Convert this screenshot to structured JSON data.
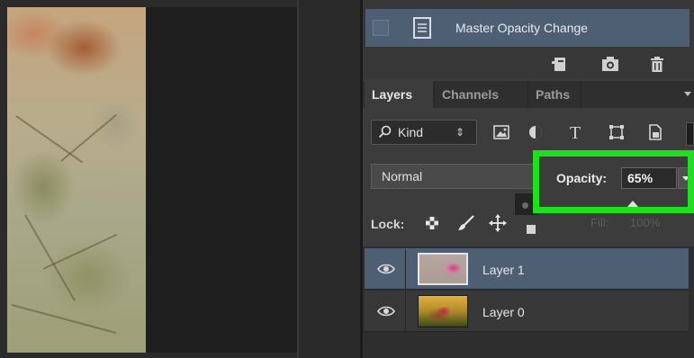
{
  "history": {
    "state_label": "Master Opacity Change",
    "buttons": [
      "new-document-from-state-icon",
      "camera-icon",
      "trash-icon"
    ]
  },
  "layers_panel": {
    "tabs": [
      {
        "label": "Layers",
        "active": true
      },
      {
        "label": "Channels",
        "active": false
      },
      {
        "label": "Paths",
        "active": false
      }
    ],
    "filter": {
      "kind_label": "Kind",
      "kind_arrows": "⇕"
    },
    "filter_icons": [
      "image-filter-icon",
      "adjustment-filter-icon",
      "type-filter-icon",
      "shape-filter-icon",
      "smart-object-filter-icon"
    ],
    "blend_mode": "Normal",
    "opacity": {
      "label": "Opacity:",
      "value": "65%"
    },
    "lock_label": "Lock:",
    "fill": {
      "label": "Fill:",
      "value": "100%"
    },
    "layers": [
      {
        "name": "Layer 1",
        "visible": true,
        "selected": true
      },
      {
        "name": "Layer 0",
        "visible": true,
        "selected": false
      }
    ]
  },
  "colors": {
    "highlight": "#1ee01e",
    "selection": "#4e5f74",
    "panel": "#3c3c3c"
  }
}
